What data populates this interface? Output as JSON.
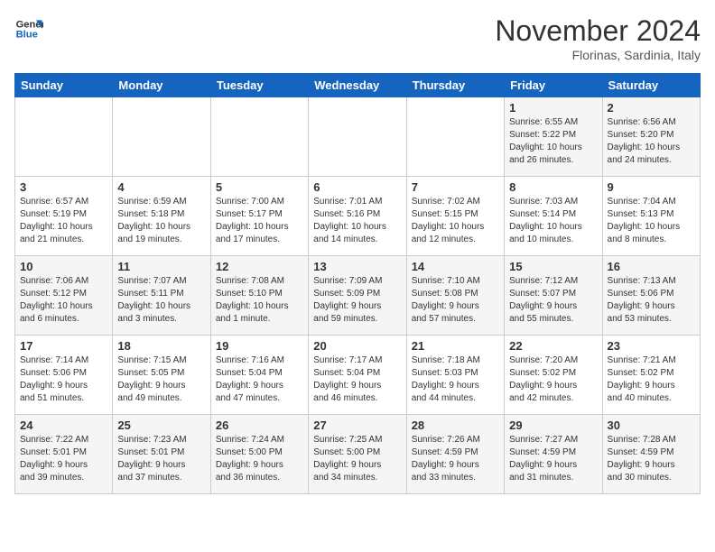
{
  "logo": {
    "line1": "General",
    "line2": "Blue"
  },
  "title": "November 2024",
  "subtitle": "Florinas, Sardinia, Italy",
  "headers": [
    "Sunday",
    "Monday",
    "Tuesday",
    "Wednesday",
    "Thursday",
    "Friday",
    "Saturday"
  ],
  "weeks": [
    [
      {
        "day": "",
        "info": ""
      },
      {
        "day": "",
        "info": ""
      },
      {
        "day": "",
        "info": ""
      },
      {
        "day": "",
        "info": ""
      },
      {
        "day": "",
        "info": ""
      },
      {
        "day": "1",
        "info": "Sunrise: 6:55 AM\nSunset: 5:22 PM\nDaylight: 10 hours\nand 26 minutes."
      },
      {
        "day": "2",
        "info": "Sunrise: 6:56 AM\nSunset: 5:20 PM\nDaylight: 10 hours\nand 24 minutes."
      }
    ],
    [
      {
        "day": "3",
        "info": "Sunrise: 6:57 AM\nSunset: 5:19 PM\nDaylight: 10 hours\nand 21 minutes."
      },
      {
        "day": "4",
        "info": "Sunrise: 6:59 AM\nSunset: 5:18 PM\nDaylight: 10 hours\nand 19 minutes."
      },
      {
        "day": "5",
        "info": "Sunrise: 7:00 AM\nSunset: 5:17 PM\nDaylight: 10 hours\nand 17 minutes."
      },
      {
        "day": "6",
        "info": "Sunrise: 7:01 AM\nSunset: 5:16 PM\nDaylight: 10 hours\nand 14 minutes."
      },
      {
        "day": "7",
        "info": "Sunrise: 7:02 AM\nSunset: 5:15 PM\nDaylight: 10 hours\nand 12 minutes."
      },
      {
        "day": "8",
        "info": "Sunrise: 7:03 AM\nSunset: 5:14 PM\nDaylight: 10 hours\nand 10 minutes."
      },
      {
        "day": "9",
        "info": "Sunrise: 7:04 AM\nSunset: 5:13 PM\nDaylight: 10 hours\nand 8 minutes."
      }
    ],
    [
      {
        "day": "10",
        "info": "Sunrise: 7:06 AM\nSunset: 5:12 PM\nDaylight: 10 hours\nand 6 minutes."
      },
      {
        "day": "11",
        "info": "Sunrise: 7:07 AM\nSunset: 5:11 PM\nDaylight: 10 hours\nand 3 minutes."
      },
      {
        "day": "12",
        "info": "Sunrise: 7:08 AM\nSunset: 5:10 PM\nDaylight: 10 hours\nand 1 minute."
      },
      {
        "day": "13",
        "info": "Sunrise: 7:09 AM\nSunset: 5:09 PM\nDaylight: 9 hours\nand 59 minutes."
      },
      {
        "day": "14",
        "info": "Sunrise: 7:10 AM\nSunset: 5:08 PM\nDaylight: 9 hours\nand 57 minutes."
      },
      {
        "day": "15",
        "info": "Sunrise: 7:12 AM\nSunset: 5:07 PM\nDaylight: 9 hours\nand 55 minutes."
      },
      {
        "day": "16",
        "info": "Sunrise: 7:13 AM\nSunset: 5:06 PM\nDaylight: 9 hours\nand 53 minutes."
      }
    ],
    [
      {
        "day": "17",
        "info": "Sunrise: 7:14 AM\nSunset: 5:06 PM\nDaylight: 9 hours\nand 51 minutes."
      },
      {
        "day": "18",
        "info": "Sunrise: 7:15 AM\nSunset: 5:05 PM\nDaylight: 9 hours\nand 49 minutes."
      },
      {
        "day": "19",
        "info": "Sunrise: 7:16 AM\nSunset: 5:04 PM\nDaylight: 9 hours\nand 47 minutes."
      },
      {
        "day": "20",
        "info": "Sunrise: 7:17 AM\nSunset: 5:04 PM\nDaylight: 9 hours\nand 46 minutes."
      },
      {
        "day": "21",
        "info": "Sunrise: 7:18 AM\nSunset: 5:03 PM\nDaylight: 9 hours\nand 44 minutes."
      },
      {
        "day": "22",
        "info": "Sunrise: 7:20 AM\nSunset: 5:02 PM\nDaylight: 9 hours\nand 42 minutes."
      },
      {
        "day": "23",
        "info": "Sunrise: 7:21 AM\nSunset: 5:02 PM\nDaylight: 9 hours\nand 40 minutes."
      }
    ],
    [
      {
        "day": "24",
        "info": "Sunrise: 7:22 AM\nSunset: 5:01 PM\nDaylight: 9 hours\nand 39 minutes."
      },
      {
        "day": "25",
        "info": "Sunrise: 7:23 AM\nSunset: 5:01 PM\nDaylight: 9 hours\nand 37 minutes."
      },
      {
        "day": "26",
        "info": "Sunrise: 7:24 AM\nSunset: 5:00 PM\nDaylight: 9 hours\nand 36 minutes."
      },
      {
        "day": "27",
        "info": "Sunrise: 7:25 AM\nSunset: 5:00 PM\nDaylight: 9 hours\nand 34 minutes."
      },
      {
        "day": "28",
        "info": "Sunrise: 7:26 AM\nSunset: 4:59 PM\nDaylight: 9 hours\nand 33 minutes."
      },
      {
        "day": "29",
        "info": "Sunrise: 7:27 AM\nSunset: 4:59 PM\nDaylight: 9 hours\nand 31 minutes."
      },
      {
        "day": "30",
        "info": "Sunrise: 7:28 AM\nSunset: 4:59 PM\nDaylight: 9 hours\nand 30 minutes."
      }
    ]
  ]
}
